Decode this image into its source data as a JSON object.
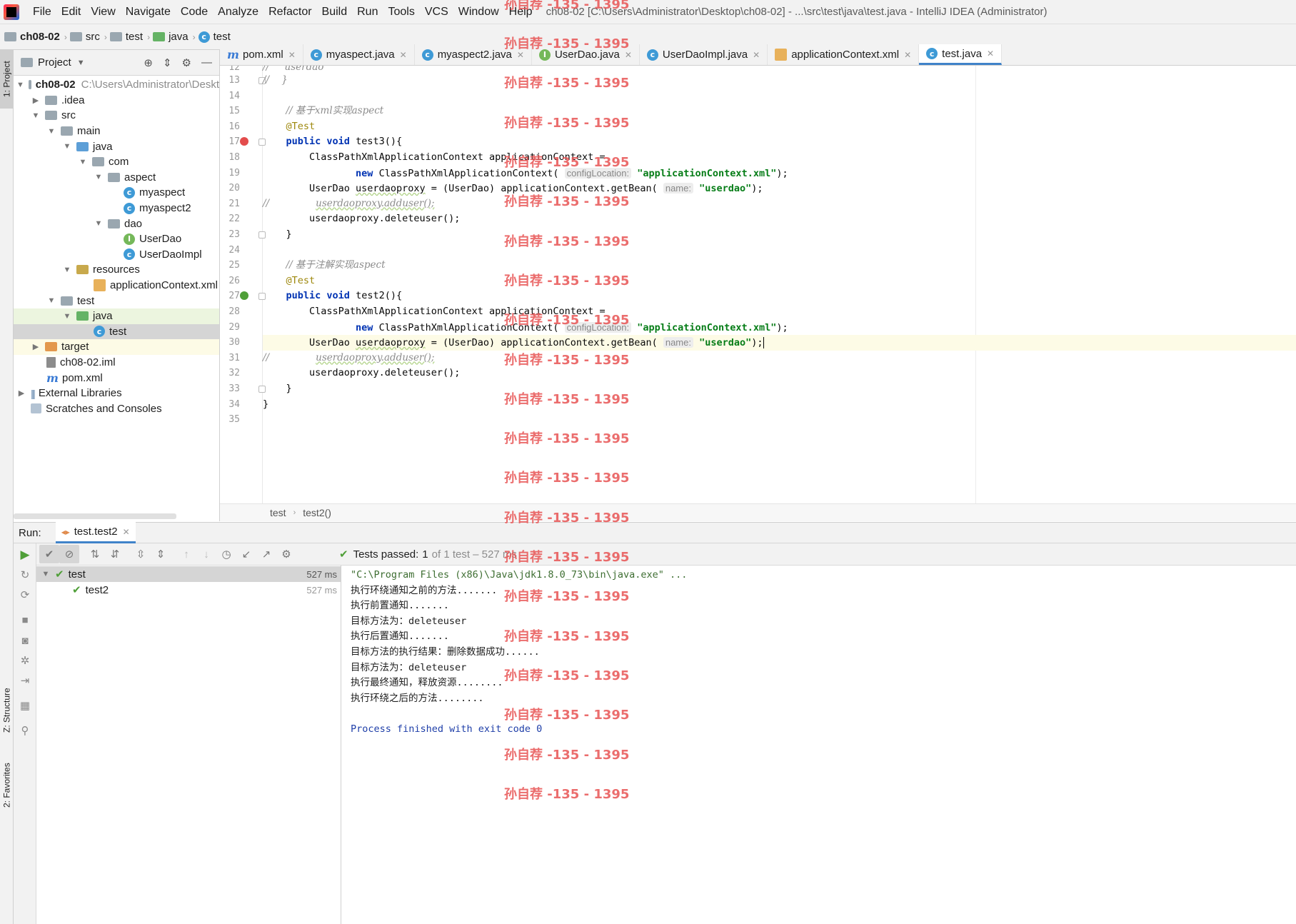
{
  "menu": {
    "items": [
      "File",
      "Edit",
      "View",
      "Navigate",
      "Code",
      "Analyze",
      "Refactor",
      "Build",
      "Run",
      "Tools",
      "VCS",
      "Window",
      "Help"
    ],
    "window_title": "ch08-02 [C:\\Users\\Administrator\\Desktop\\ch08-02] - ...\\src\\test\\java\\test.java - IntelliJ IDEA (Administrator)"
  },
  "navbar": {
    "crumbs": [
      "ch08-02",
      "src",
      "test",
      "java",
      "test"
    ]
  },
  "left_strip": {
    "project_tab": "1: Project",
    "structure_tab": "Z: Structure",
    "favorites_tab": "2: Favorites"
  },
  "project_panel": {
    "title": "Project",
    "tree": [
      {
        "label": "ch08-02",
        "path": "C:\\Users\\Administrator\\Deskt",
        "icon": "module-folder-icon"
      },
      {
        "label": ".idea",
        "icon": "folder-icon"
      },
      {
        "label": "src",
        "icon": "folder-icon"
      },
      {
        "label": "main",
        "icon": "folder-icon"
      },
      {
        "label": "java",
        "icon": "source-folder-icon"
      },
      {
        "label": "com",
        "icon": "package-icon"
      },
      {
        "label": "aspect",
        "icon": "package-icon"
      },
      {
        "label": "myaspect",
        "icon": "class-icon"
      },
      {
        "label": "myaspect2",
        "icon": "class-icon"
      },
      {
        "label": "dao",
        "icon": "package-icon"
      },
      {
        "label": "UserDao",
        "icon": "interface-icon"
      },
      {
        "label": "UserDaoImpl",
        "icon": "class-icon"
      },
      {
        "label": "resources",
        "icon": "resources-folder-icon"
      },
      {
        "label": "applicationContext.xml",
        "icon": "xml-file-icon"
      },
      {
        "label": "test",
        "icon": "folder-icon"
      },
      {
        "label": "java",
        "icon": "test-folder-icon"
      },
      {
        "label": "test",
        "icon": "test-class-icon"
      },
      {
        "label": "target",
        "icon": "excluded-folder-icon"
      },
      {
        "label": "ch08-02.iml",
        "icon": "iml-file-icon"
      },
      {
        "label": "pom.xml",
        "icon": "maven-icon"
      },
      {
        "label": "External Libraries",
        "icon": "libraries-icon"
      },
      {
        "label": "Scratches and Consoles",
        "icon": "scratches-icon"
      }
    ]
  },
  "tabs": [
    {
      "label": "pom.xml",
      "icon": "maven-icon"
    },
    {
      "label": "myaspect.java",
      "icon": "class-icon"
    },
    {
      "label": "myaspect2.java",
      "icon": "class-icon"
    },
    {
      "label": "UserDao.java",
      "icon": "interface-icon"
    },
    {
      "label": "UserDaoImpl.java",
      "icon": "class-icon"
    },
    {
      "label": "applicationContext.xml",
      "icon": "xml-file-icon"
    },
    {
      "label": "test.java",
      "icon": "test-class-icon"
    }
  ],
  "editor": {
    "first_line_fragment": "//     userdao",
    "line_numbers": [
      "12",
      "13",
      "14",
      "15",
      "16",
      "17",
      "18",
      "19",
      "20",
      "21",
      "22",
      "23",
      "24",
      "25",
      "26",
      "27",
      "28",
      "29",
      "30",
      "31",
      "32",
      "33",
      "34",
      "35"
    ],
    "comment_xml": "// 基于xml实现aspect",
    "comment_annotation": "// 基于注解实现aspect",
    "annotation": "@Test",
    "method_test3": "test3",
    "method_test2": "test2",
    "ctx_type": "ClassPathXmlApplicationContext",
    "ctx_var": "applicationContext",
    "hint_config": "configLocation:",
    "hint_name": "name:",
    "xml_file": "\"applicationContext.xml\"",
    "bean_name": "\"userdao\"",
    "proxy_var": "userdaoproxy",
    "adduser_call": "userdaoproxy.adduser();",
    "deleteuser_call": "userdaoproxy.deleteuser();"
  },
  "editor_breadcrumb": [
    "test",
    "test2()"
  ],
  "run_panel": {
    "label": "Run:",
    "tab": "test.test2",
    "status_prefix": "Tests passed:",
    "status_count": "1",
    "status_rest": "of 1 test – 527 ms",
    "results": [
      {
        "name": "test",
        "time": "527 ms"
      },
      {
        "name": "test2",
        "time": "527 ms"
      }
    ],
    "console": [
      "\"C:\\Program Files (x86)\\Java\\jdk1.8.0_73\\bin\\java.exe\" ...",
      "执行环绕通知之前的方法.......",
      "执行前置通知.......",
      "目标方法为：deleteuser",
      "执行后置通知.......",
      "目标方法的执行结果：删除数据成功......",
      "目标方法为：deleteuser",
      "执行最终通知，释放资源........",
      "执行环绕之后的方法........",
      "",
      "Process finished with exit code 0"
    ]
  },
  "watermark": "孙自荐 -135 - 1395"
}
